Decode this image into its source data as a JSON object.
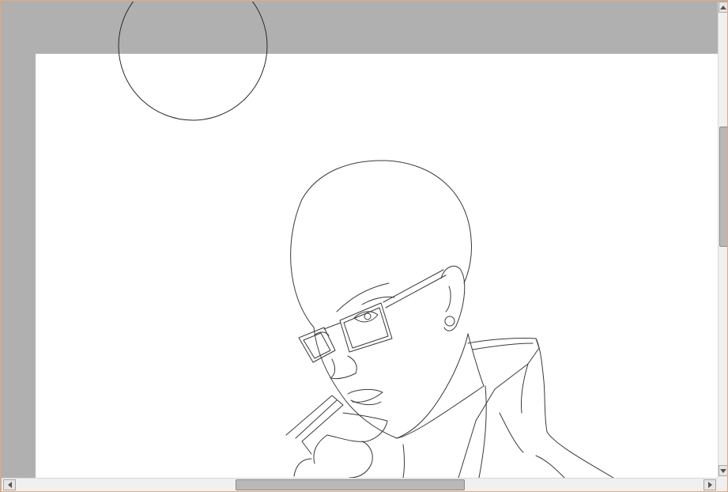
{
  "window": {
    "border_color": "#e8a878",
    "workspace_color": "#b0b0b0",
    "paper_color": "#ffffff"
  },
  "canvas": {
    "subject": "line-art-bald-figure-with-glasses",
    "brush_cursor": "circle-brush-cursor"
  },
  "scrollbars": {
    "vertical": {
      "up_icon": "arrow-up-icon",
      "down_icon": "arrow-down-icon",
      "position": 0.25
    },
    "horizontal": {
      "left_icon": "arrow-left-icon",
      "right_icon": "arrow-right-icon",
      "position": 0.33
    }
  }
}
